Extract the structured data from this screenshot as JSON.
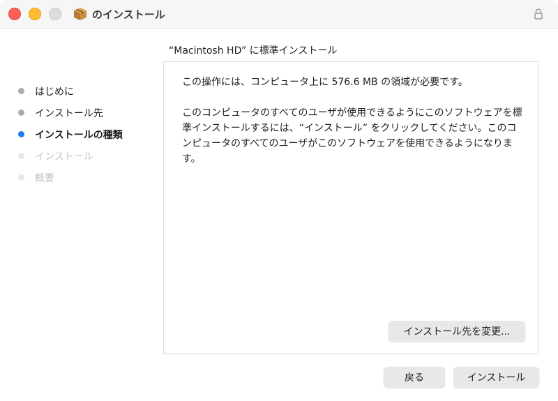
{
  "window": {
    "title": "のインストール"
  },
  "header": {
    "text": "“Macintosh HD” に標準インストール"
  },
  "sidebar": {
    "steps": [
      {
        "label": "はじめに",
        "state": "done"
      },
      {
        "label": "インストール先",
        "state": "done"
      },
      {
        "label": "インストールの種類",
        "state": "current"
      },
      {
        "label": "インストール",
        "state": "future"
      },
      {
        "label": "概要",
        "state": "future"
      }
    ]
  },
  "panel": {
    "paragraph1": "この操作には、コンピュータ上に 576.6 MB の領域が必要です。",
    "paragraph2": "このコンピュータのすべてのユーザが使用できるようにこのソフトウェアを標準インストールするには、“インストール” をクリックしてください。このコンピュータのすべてのユーザがこのソフトウェアを使用できるようになります。",
    "change_location_label": "インストール先を変更..."
  },
  "buttons": {
    "back_label": "戻る",
    "install_label": "インストール"
  },
  "colors": {
    "accent": "#1d7cf2",
    "close": "#fe5f57",
    "minimize": "#febc2e",
    "zoom_inactive": "#dcdcdc"
  },
  "icons": {
    "app": "package-icon",
    "lock": "lock-icon"
  }
}
